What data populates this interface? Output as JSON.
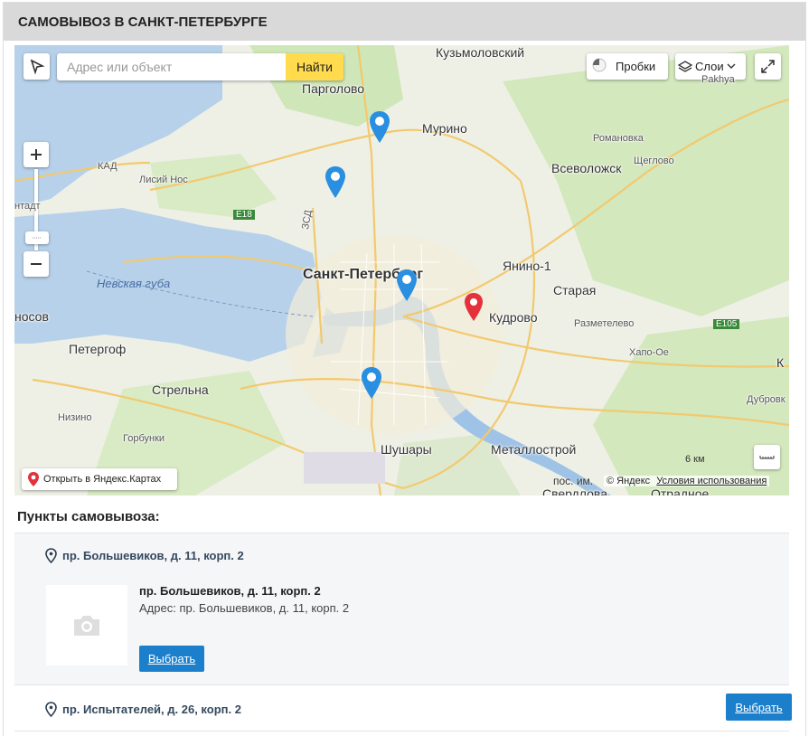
{
  "header": {
    "title": "САМОВЫВОЗ В САНКТ-ПЕТЕРБУРГЕ"
  },
  "map": {
    "search_placeholder": "Адрес или объект",
    "search_button": "Найти",
    "traffic_label": "Пробки",
    "layers_label": "Слои",
    "open_in_yandex": "Открыть в Яндекс.Картах",
    "scale_label": "6 км",
    "copyright": "© Яндекс",
    "terms_link": "Условия использования",
    "labels": {
      "kuzmolovsky": "Кузьмоловский",
      "pargolovo": "Парголово",
      "murino": "Мурино",
      "romanovka": "Романовка",
      "vsevolozhsk": "Всеволожск",
      "shcheglovo": "Щеглово",
      "lisiy_nos": "Лисий Нос",
      "kad": "КАД",
      "zsd": "ЗСД",
      "e18": "E18",
      "e105": "E105",
      "yanino": "Янино-1",
      "staraya": "Старая",
      "spb": "Санкт-Петербург",
      "nevskaya": "Невская губа",
      "kudrovo": "Кудрово",
      "razmetelevo": "Разметелево",
      "khapo": "Хапо-Ое",
      "peterhof": "Петергоф",
      "strelna": "Стрельна",
      "nizino": "Низино",
      "gorbunki": "Горбунки",
      "shushary": "Шушары",
      "metallostroy": "Металлострой",
      "dubrovka": "Дубровк",
      "posim": "пос. им.",
      "sverdlova": "Свердлова",
      "otradnoe": "Отрадное",
      "nosov": "носов",
      "tadt": "нтадт",
      "pakhya": "Pakhya",
      "k_edge": "К"
    }
  },
  "pickup": {
    "title": "Пункты самовывоза:",
    "points": [
      {
        "name": "пр. Большевиков, д. 11, корп. 2",
        "detail_name": "пр. Большевиков, д. 11, корп. 2",
        "address": "Адрес: пр. Большевиков, д. 11, корп. 2",
        "button": "Выбрать"
      },
      {
        "name": "пр. Испытателей, д. 26, корп. 2",
        "button": "Выбрать"
      }
    ]
  },
  "colors": {
    "accent": "#1b7fcc",
    "pin_blue": "#2a8fe0",
    "pin_red": "#e3323c",
    "water": "#b7d1ea"
  }
}
